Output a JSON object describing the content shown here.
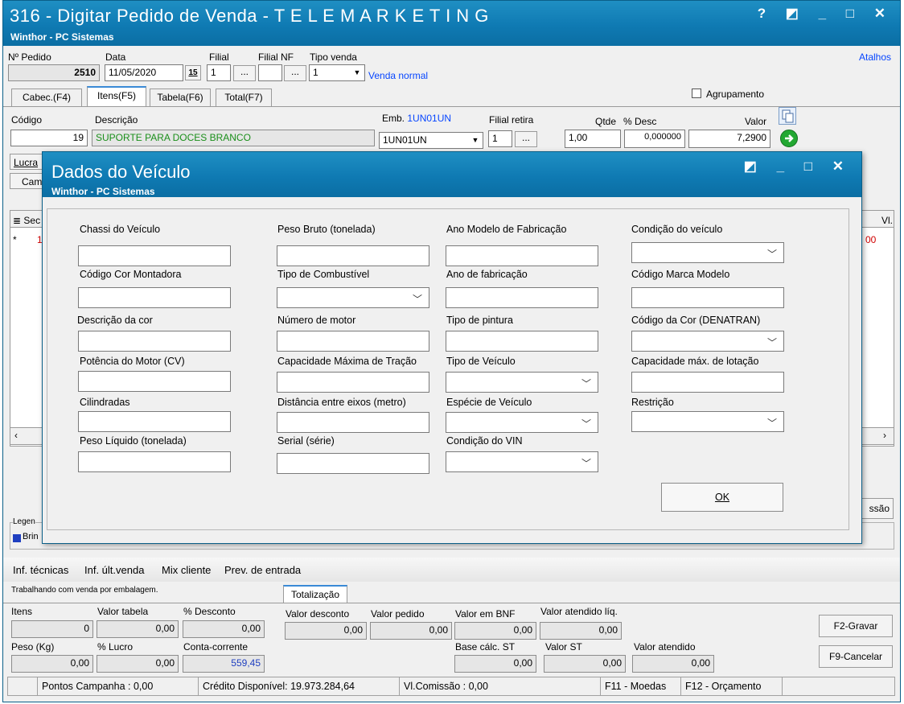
{
  "main_window": {
    "title": "316 - Digitar Pedido de Venda - T E L E M A R K E T I N G",
    "subtitle": "Winthor - PC Sistemas",
    "controls": "? ◩ _ □ ✕",
    "shortcuts_link": "Atalhos"
  },
  "header": {
    "pedido_label": "Nº Pedido",
    "pedido_value": "2510",
    "data_label": "Data",
    "data_value": "11/05/2020",
    "calendar_icon_text": "15",
    "filial_label": "Filial",
    "filial_value": "1",
    "filial_nf_label": "Filial NF",
    "filial_nf_value": "",
    "tipo_venda_label": "Tipo venda",
    "tipo_venda_value": "1",
    "tipo_venda_desc": "Venda normal",
    "dots": "..."
  },
  "tabs": [
    "Cabec.(F4)",
    "Itens(F5)",
    "Tabela(F6)",
    "Total(F7)"
  ],
  "agrupamento_label": "Agrupamento",
  "item_row": {
    "codigo_label": "Código",
    "codigo_value": "19",
    "descricao_label": "Descrição",
    "descricao_value": "SUPORTE PARA DOCES BRANCO",
    "emb_label": "Emb.",
    "emb_link": "1UN01UN",
    "emb_value": "1UN01UN",
    "filial_retira_label": "Filial retira",
    "filial_retira_value": "1",
    "qtde_label": "Qtde",
    "qtde_value": "1,00",
    "desc_label": "% Desc",
    "desc_value": "0,000000",
    "valor_label": "Valor",
    "valor_value": "7,2900"
  },
  "left_buttons": [
    "Lucra",
    "Cam"
  ],
  "grid": {
    "seq_header": "Sec",
    "vl_header": "Vl.",
    "row_marker": "*",
    "row_seq": "1",
    "row_vl": "00"
  },
  "right_partial_button": "ssão",
  "legend": {
    "label": "Legen",
    "item": "Brin"
  },
  "bottom_links": [
    "Inf. técnicas",
    "Inf. últ.venda",
    "Mix cliente",
    "Prev. de entrada"
  ],
  "working_text": "Trabalhando com venda por embalagem.",
  "totalizacao_tab": "Totalização",
  "totals": {
    "itens_label": "Itens",
    "itens_value": "0",
    "valor_tabela_label": "Valor tabela",
    "valor_tabela_value": "0,00",
    "pct_desconto_label": "% Desconto",
    "pct_desconto_value": "0,00",
    "valor_desconto_label": "Valor desconto",
    "valor_desconto_value": "0,00",
    "valor_pedido_label": "Valor pedido",
    "valor_pedido_value": "0,00",
    "valor_bnf_label": "Valor em BNF",
    "valor_bnf_value": "0,00",
    "valor_atendido_liq_label": "Valor atendido líq.",
    "valor_atendido_liq_value": "0,00",
    "peso_label": "Peso (Kg)",
    "peso_value": "0,00",
    "pct_lucro_label": "% Lucro",
    "pct_lucro_value": "0,00",
    "conta_corrente_label": "Conta-corrente",
    "conta_corrente_value": "559,45",
    "base_st_label": "Base cálc. ST",
    "base_st_value": "0,00",
    "valor_st_label": "Valor ST",
    "valor_st_value": "0,00",
    "valor_atendido_label": "Valor atendido",
    "valor_atendido_value": "0,00"
  },
  "action_buttons": {
    "gravar": "F2-Gravar",
    "cancelar": "F9-Cancelar"
  },
  "statusbar": {
    "pontos": "Pontos Campanha : 0,00",
    "credito": "Crédito Disponível: 19.973.284,64",
    "comissao": "Vl.Comissão : 0,00",
    "moedas": "F11 - Moedas",
    "orcamento": "F12 - Orçamento"
  },
  "dialog": {
    "title": "Dados do Veículo",
    "subtitle": "Winthor - PC Sistemas",
    "controls": "◩ _ □ ✕",
    "ok_label": "OK",
    "fields": {
      "chassi": "Chassi do Veículo",
      "peso_bruto": "Peso Bruto (tonelada)",
      "ano_modelo": "Ano Modelo de Fabricação",
      "condicao_veiculo": "Condição do veículo",
      "cor_montadora": "Código Cor Montadora",
      "tipo_combustivel": "Tipo de Combustível",
      "ano_fabricacao": "Ano de fabricação",
      "marca_modelo": "Código Marca Modelo",
      "descricao_cor": "Descrição da cor",
      "numero_motor": "Número de motor",
      "tipo_pintura": "Tipo de pintura",
      "cor_denatran": "Código da Cor (DENATRAN)",
      "potencia_motor": "Potência do Motor (CV)",
      "cap_tracao": "Capacidade Máxima de Tração",
      "tipo_veiculo": "Tipo de Veículo",
      "cap_lotacao": "Capacidade máx. de lotação",
      "cilindradas": "Cilindradas",
      "distancia_eixos": "Distância entre eixos (metro)",
      "especie_veiculo": "Espécie de Veículo",
      "restricao": "Restrição",
      "peso_liquido": "Peso Líquido (tonelada)",
      "serial": "Serial (série)",
      "condicao_vin": "Condição do VIN"
    }
  },
  "colors": {
    "titlebar": "#0f7ab3",
    "link": "#0645ff",
    "green_text": "#1a8f1a",
    "red_text": "#d00000"
  },
  "icons": [
    "copy-icon",
    "go-arrow-icon",
    "calendar-icon",
    "chevron-down-icon",
    "help-icon",
    "restore-icon",
    "minimize-icon",
    "maximize-icon",
    "close-icon"
  ]
}
